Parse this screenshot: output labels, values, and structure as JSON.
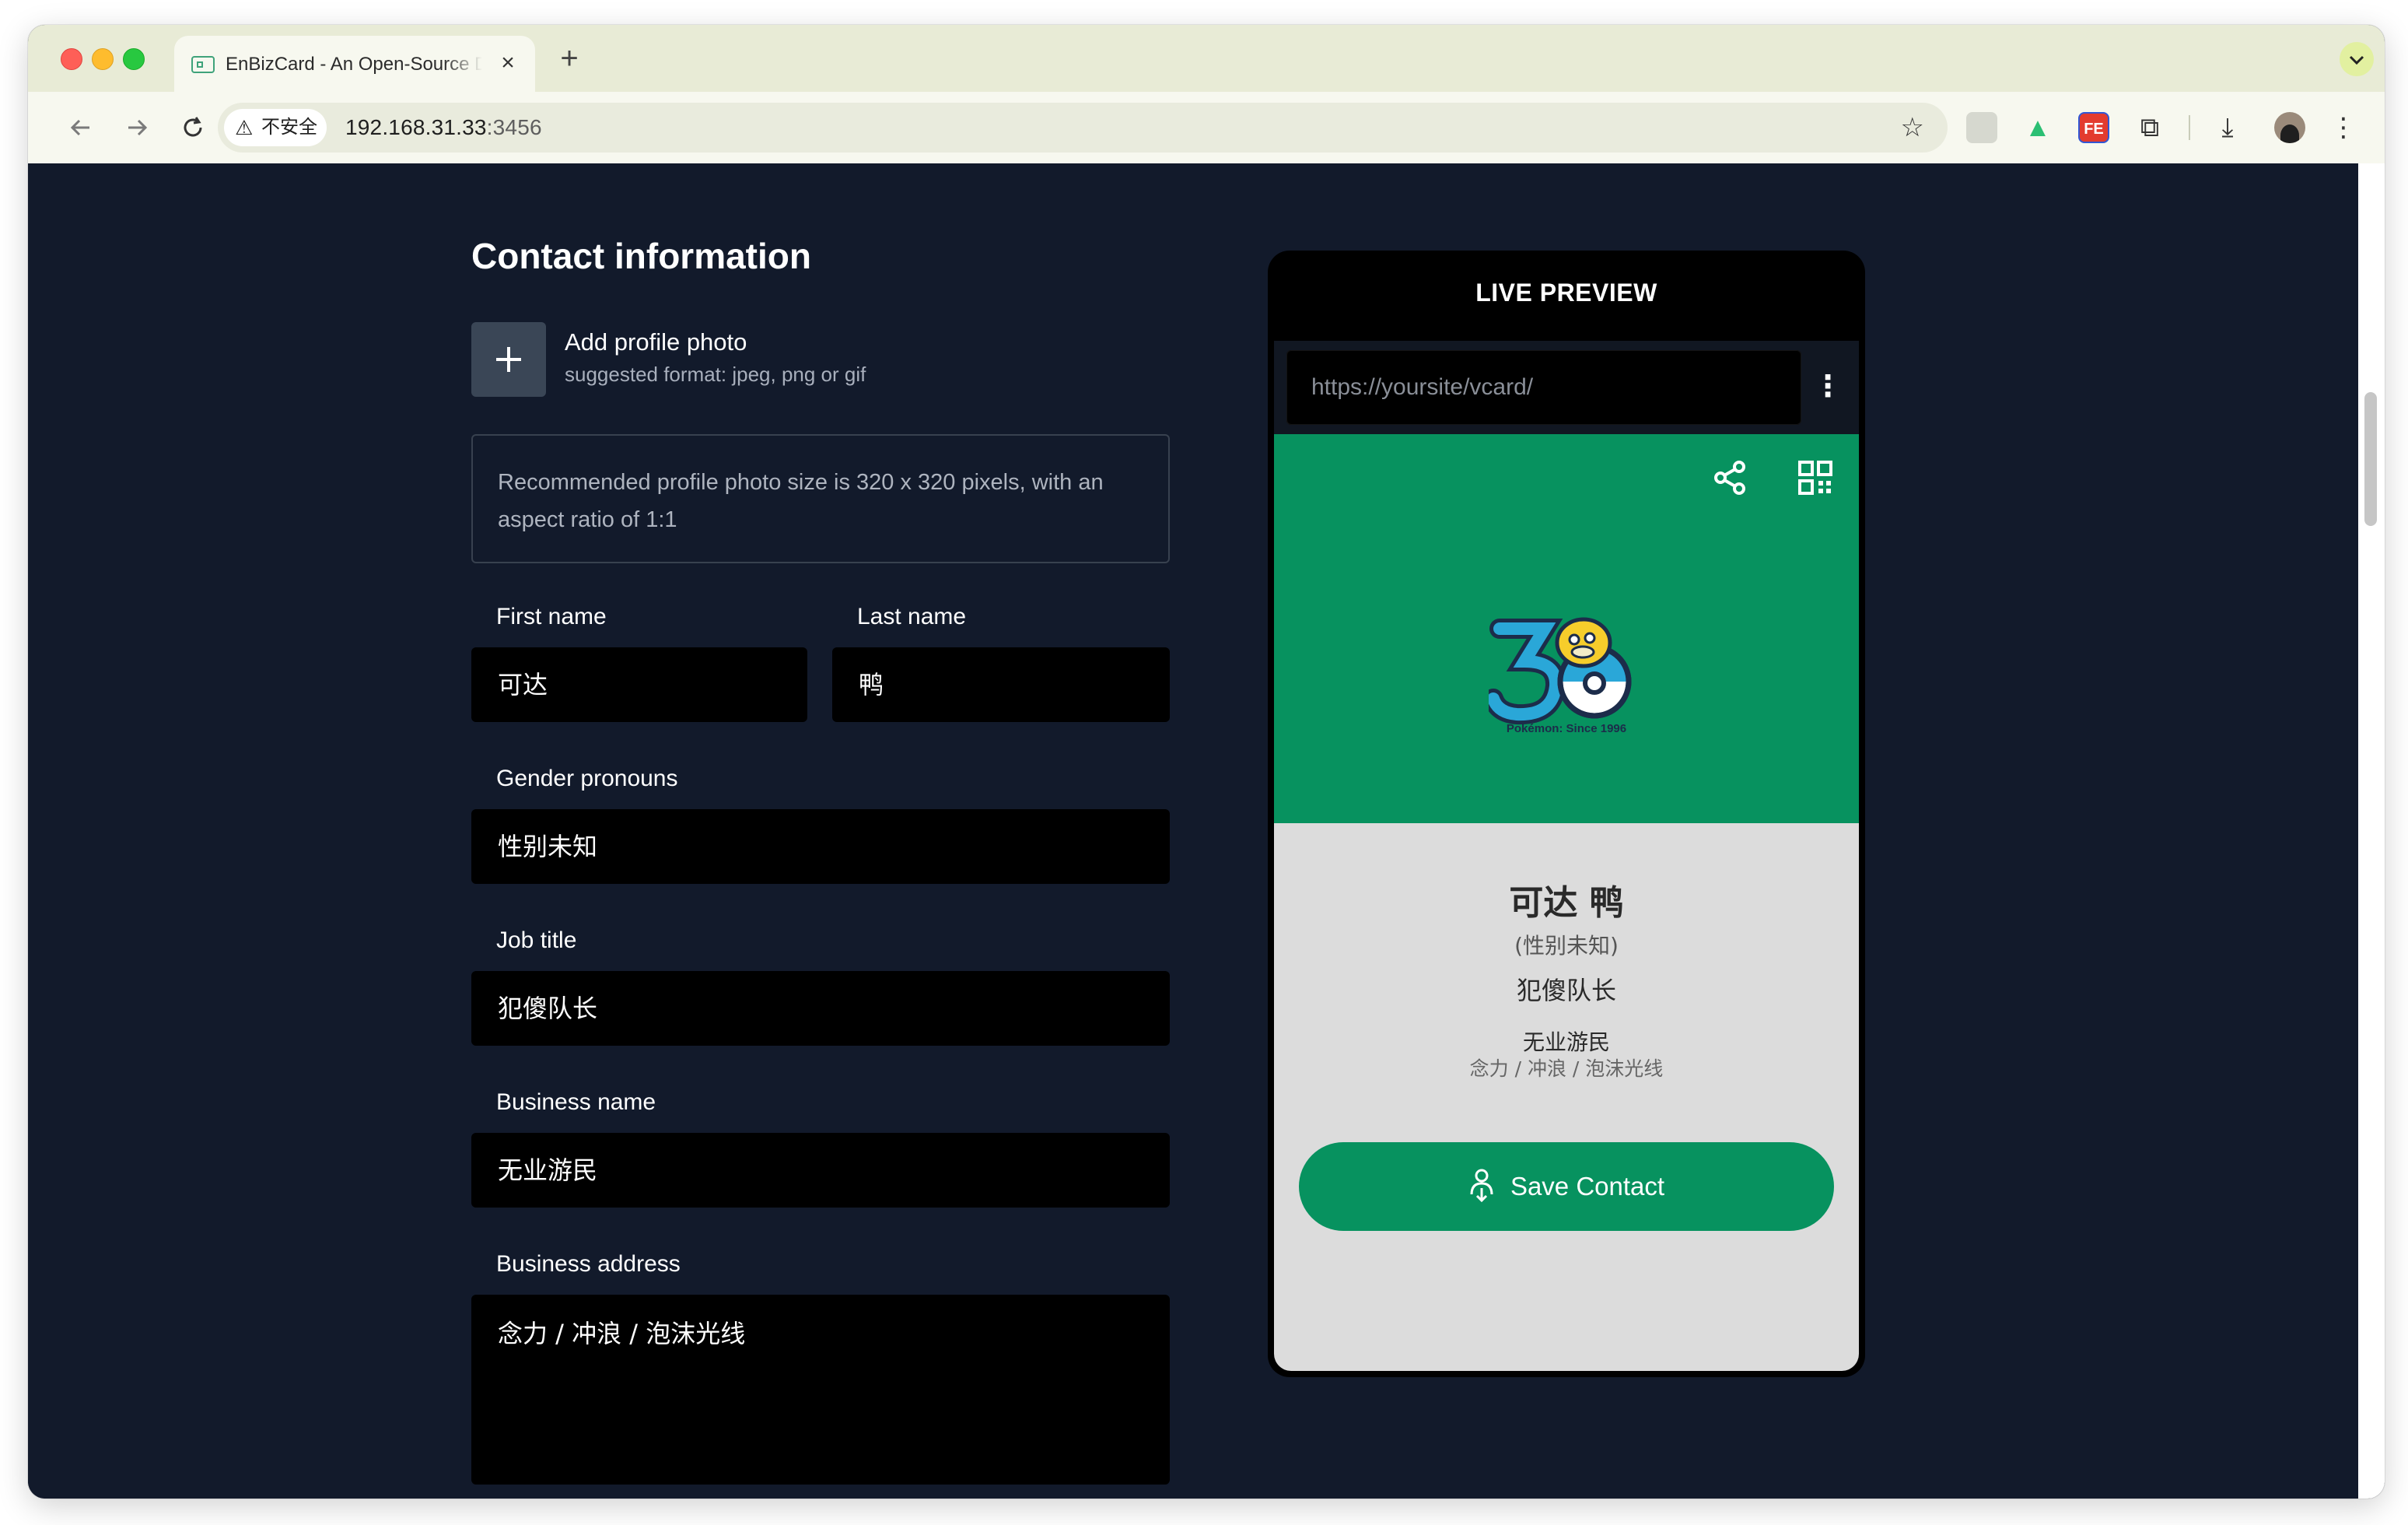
{
  "browser": {
    "tab_title": "EnBizCard - An Open-Source Digital Business Card Generator",
    "tab_close": "×",
    "new_tab": "+",
    "insecure_label": "不安全",
    "url_host": "192.168.31.33",
    "url_port": ":3456"
  },
  "form": {
    "title": "Contact information",
    "add_photo_label": "Add profile photo",
    "add_photo_hint": "suggested format: jpeg, png or gif",
    "photo_note": "Recommended profile photo size is 320 x 320 pixels, with an aspect ratio of 1:1",
    "first_name_label": "First name",
    "first_name_value": "可达",
    "last_name_label": "Last name",
    "last_name_value": "鸭",
    "pronouns_label": "Gender pronouns",
    "pronouns_value": "性别未知",
    "job_title_label": "Job title",
    "job_title_value": "犯傻队长",
    "business_name_label": "Business name",
    "business_name_value": "无业游民",
    "business_address_label": "Business address",
    "business_address_value": "念力 / 冲浪 / 泡沫光线"
  },
  "preview": {
    "title": "LIVE PREVIEW",
    "url_placeholder": "https://yoursite/vcard/",
    "logo_caption": "Pokémon: Since 1996",
    "name": "可达 鸭",
    "pronouns": "(性别未知)",
    "job_title": "犯傻队长",
    "business_name": "无业游民",
    "business_address": "念力 / 冲浪 / 泡沫光线",
    "save_button": "Save Contact"
  },
  "colors": {
    "page_bg": "#121a2b",
    "accent_green": "#07925f",
    "field_bg": "#000000",
    "card_bg": "#dcdcdc"
  }
}
